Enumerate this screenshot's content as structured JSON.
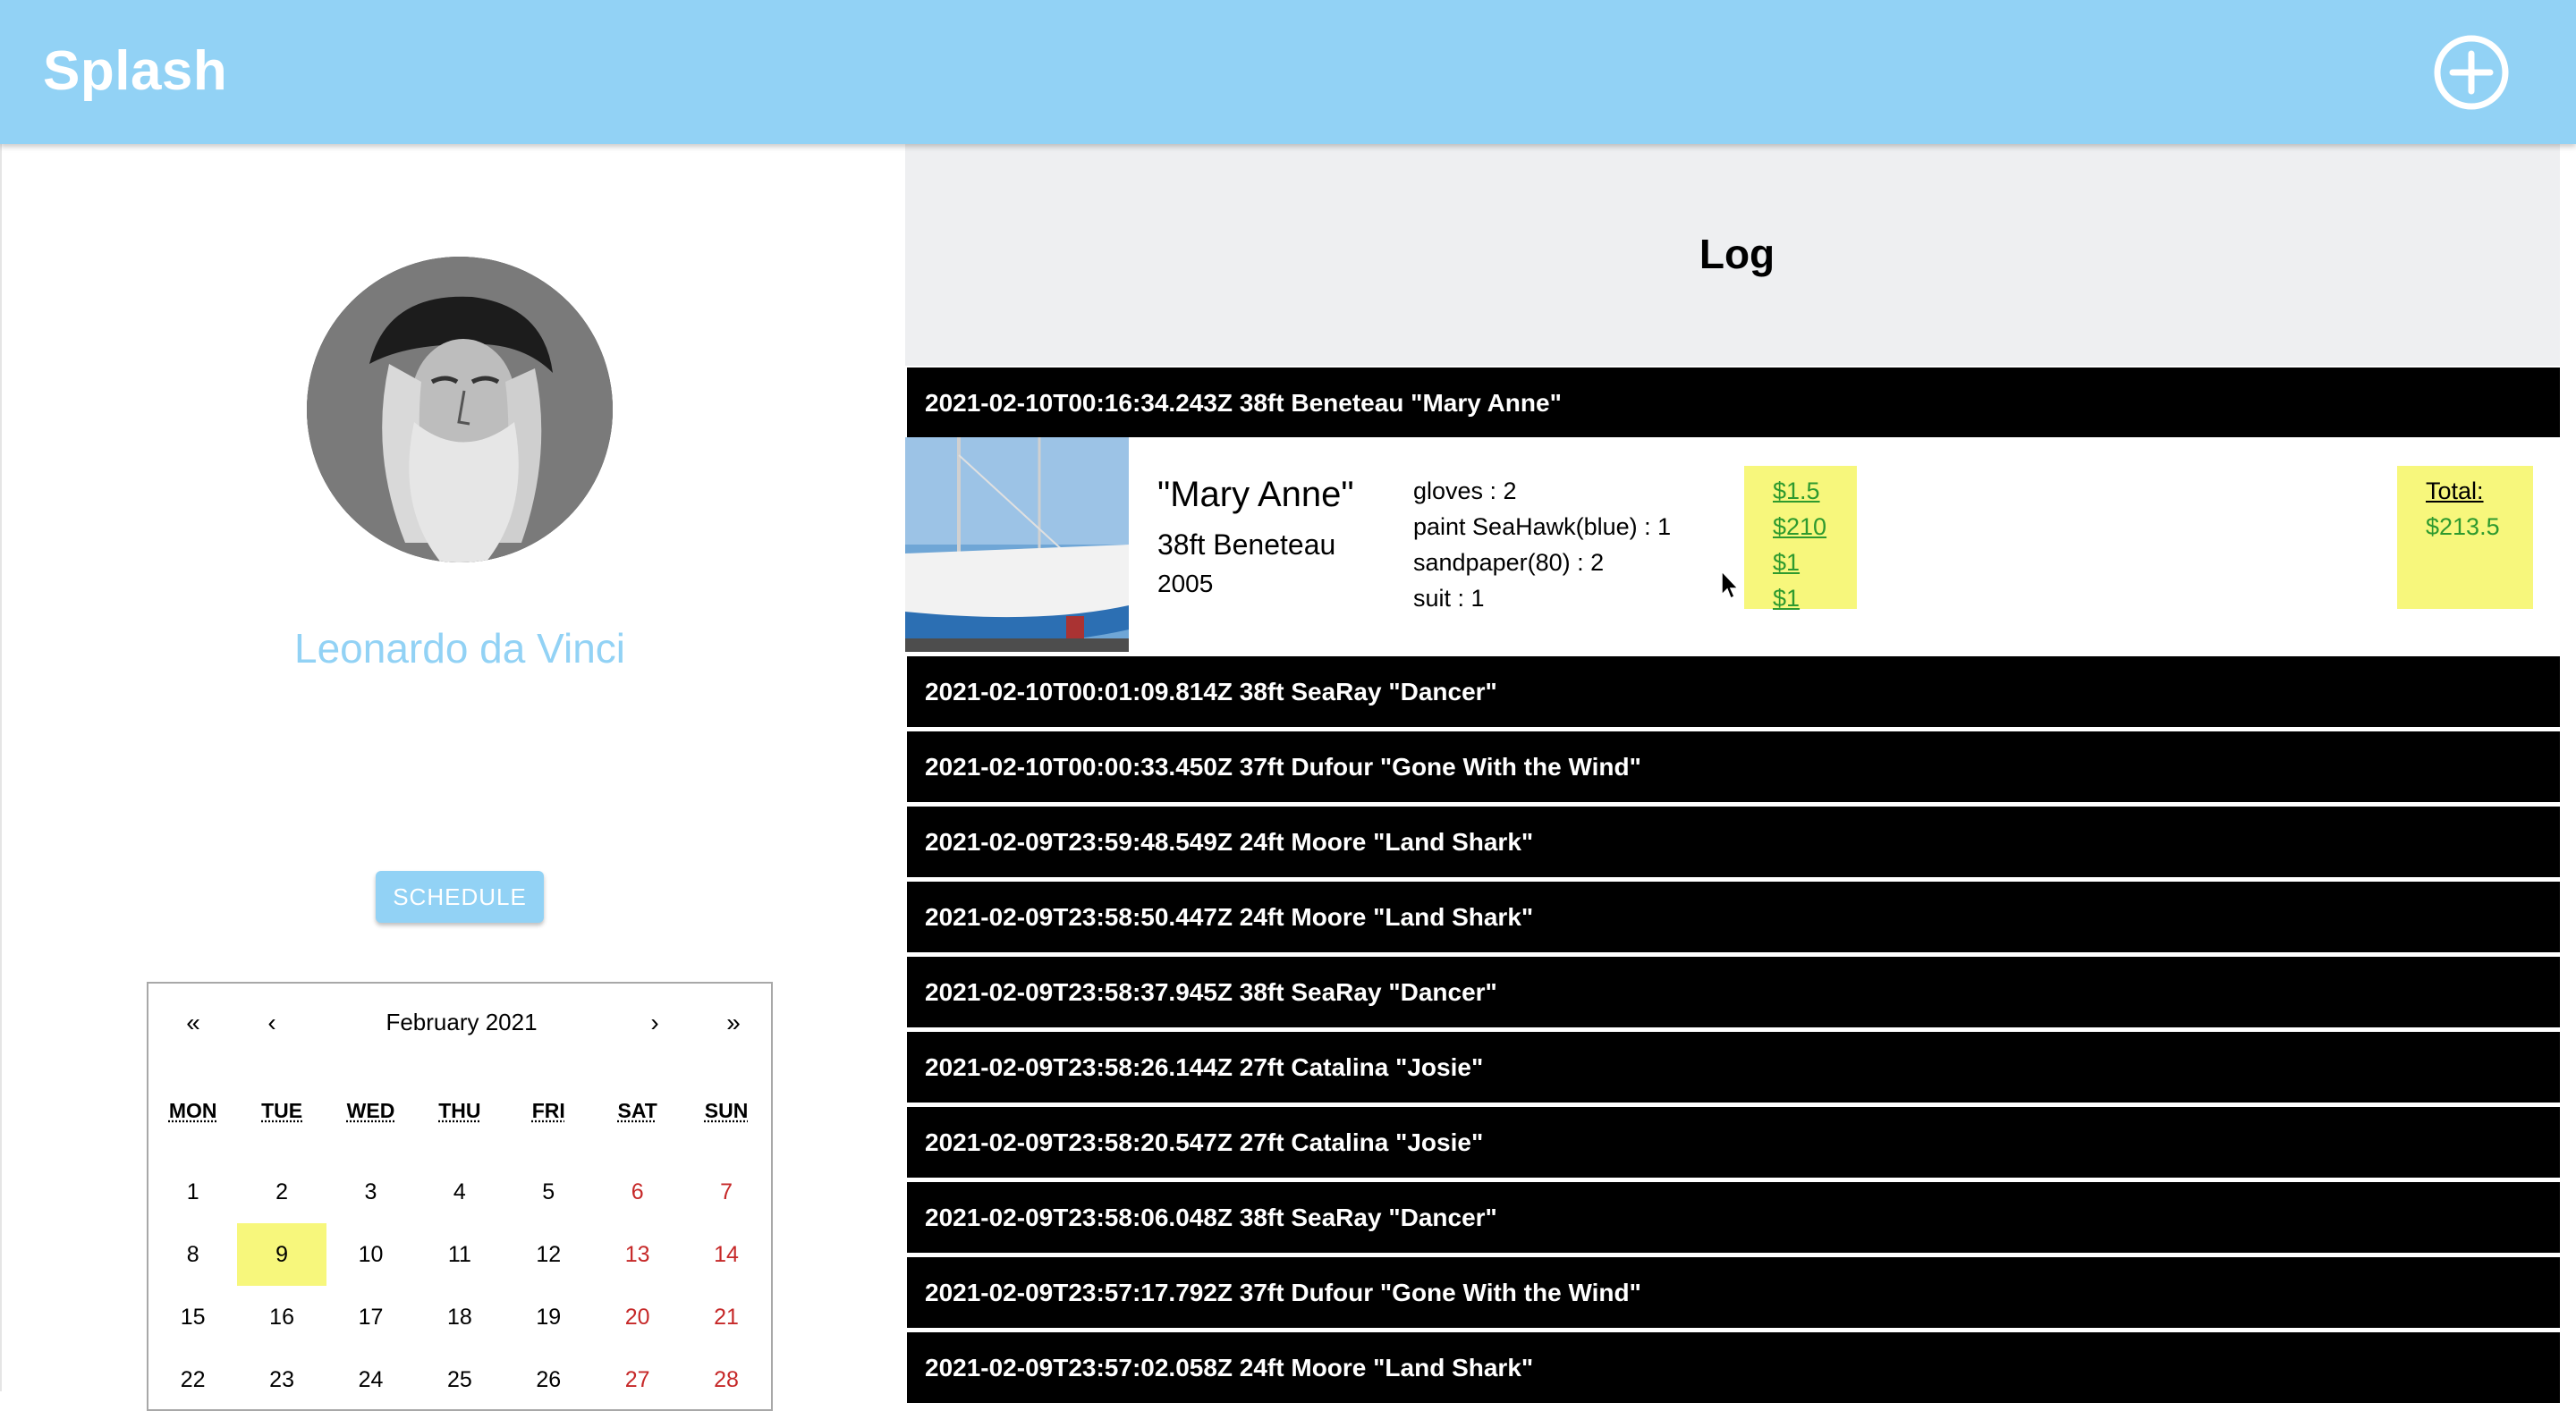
{
  "app": {
    "title": "Splash",
    "add_icon": "plus-circle-icon"
  },
  "profile": {
    "name": "Leonardo da Vinci",
    "schedule_label": "SCHEDULE"
  },
  "calendar": {
    "nav": {
      "prev_year": "«",
      "prev_month": "‹",
      "next_month": "›",
      "next_year": "»"
    },
    "month_label": "February 2021",
    "weekdays": [
      "MON",
      "TUE",
      "WED",
      "THU",
      "FRI",
      "SAT",
      "SUN"
    ],
    "weeks": [
      [
        "1",
        "2",
        "3",
        "4",
        "5",
        "6",
        "7"
      ],
      [
        "8",
        "9",
        "10",
        "11",
        "12",
        "13",
        "14"
      ],
      [
        "15",
        "16",
        "17",
        "18",
        "19",
        "20",
        "21"
      ],
      [
        "22",
        "23",
        "24",
        "25",
        "26",
        "27",
        "28"
      ]
    ],
    "selected_day": "9",
    "colors": {
      "weekend": "#c62828",
      "selected": "#f7f77c"
    }
  },
  "log": {
    "title": "Log",
    "entries": [
      "2021-02-10T00:16:34.243Z 38ft Beneteau \"Mary Anne\"",
      "2021-02-10T00:01:09.814Z 38ft SeaRay \"Dancer\"",
      "2021-02-10T00:00:33.450Z 37ft Dufour \"Gone With the Wind\"",
      "2021-02-09T23:59:48.549Z 24ft Moore \"Land Shark\"",
      "2021-02-09T23:58:50.447Z 24ft Moore \"Land Shark\"",
      "2021-02-09T23:58:37.945Z 38ft SeaRay \"Dancer\"",
      "2021-02-09T23:58:26.144Z 27ft Catalina \"Josie\"",
      "2021-02-09T23:58:20.547Z 27ft Catalina \"Josie\"",
      "2021-02-09T23:58:06.048Z 38ft SeaRay \"Dancer\"",
      "2021-02-09T23:57:17.792Z 37ft Dufour \"Gone With the Wind\"",
      "2021-02-09T23:57:02.058Z 24ft Moore \"Land Shark\""
    ],
    "detail": {
      "boat_name": "\"Mary Anne\"",
      "boat_model": "38ft Beneteau",
      "boat_year": "2005",
      "items": [
        "gloves : 2",
        "paint SeaHawk(blue) : 1",
        "sandpaper(80) : 2",
        "suit : 1"
      ],
      "prices": [
        "$1.5",
        "$210",
        "$1",
        "$1"
      ],
      "total_label": "Total:",
      "total_value": "$213.5"
    }
  },
  "colors": {
    "appbar": "#92d2f5",
    "accent_text": "#92d2f5",
    "log_row": "#000000",
    "highlight": "#f7f77c",
    "price_text": "#2e9a2e"
  }
}
